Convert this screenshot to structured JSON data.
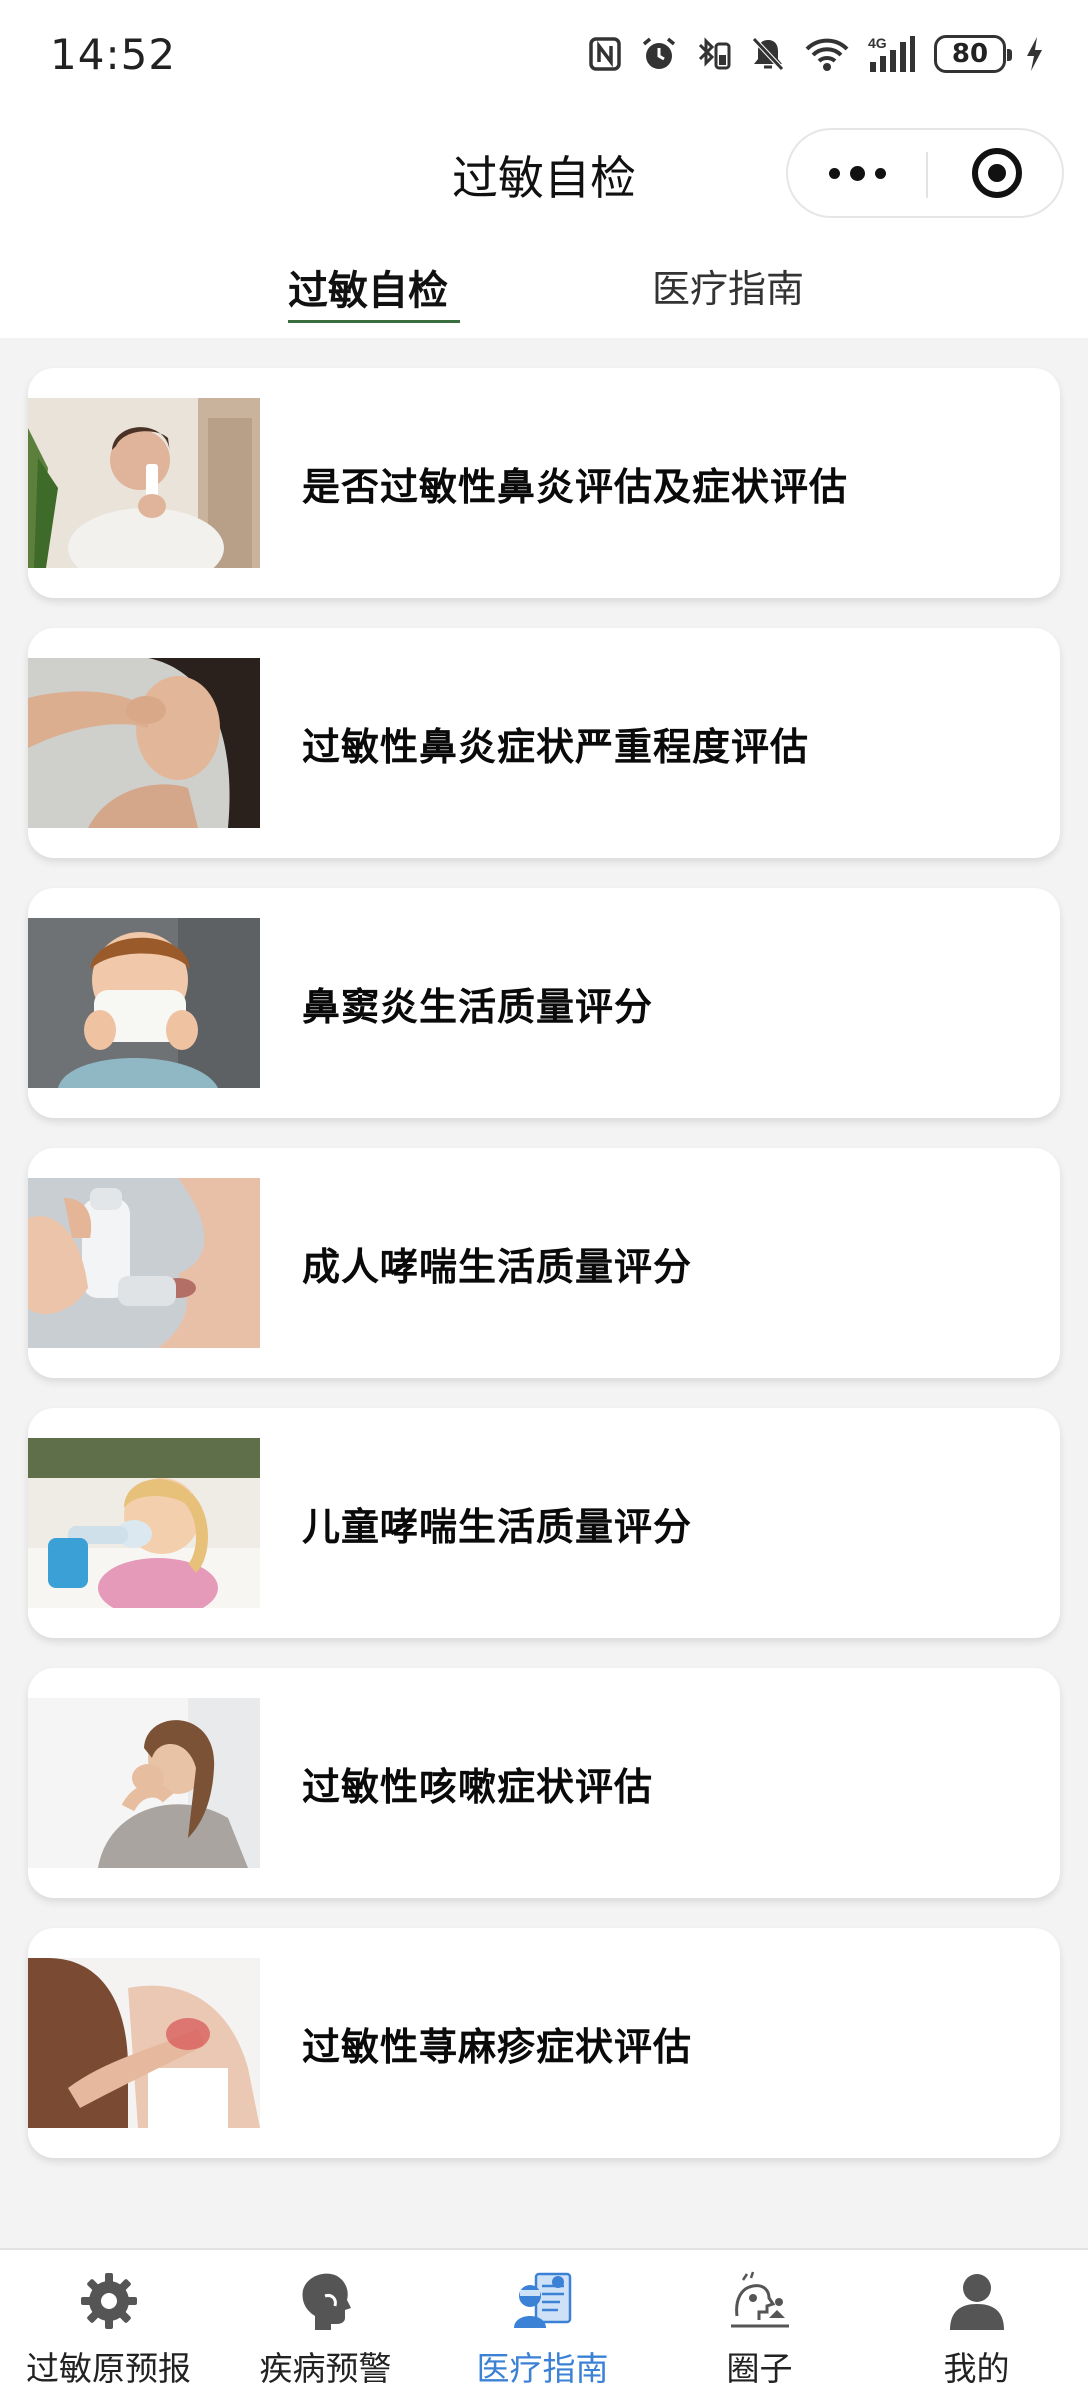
{
  "status_bar": {
    "time": "14:52",
    "battery": "80",
    "network": "4G",
    "icons": [
      "nfc-icon",
      "alarm-icon",
      "bluetooth-icon",
      "mute-icon",
      "wifi-icon",
      "signal-icon",
      "battery-icon",
      "charging-icon"
    ]
  },
  "nav": {
    "title": "过敏自检",
    "more_icon": "more-dots-icon",
    "close_icon": "target-close-icon"
  },
  "tabs": [
    {
      "label": "过敏自检",
      "active": true
    },
    {
      "label": "医疗指南",
      "active": false
    }
  ],
  "cards": [
    {
      "title": "是否过敏性鼻炎评估及症状评估",
      "image": "woman-nasal-spray-photo"
    },
    {
      "title": "过敏性鼻炎症状严重程度评估",
      "image": "woman-pinching-nose-photo"
    },
    {
      "title": "鼻窦炎生活质量评分",
      "image": "boy-blowing-nose-photo"
    },
    {
      "title": "成人哮喘生活质量评分",
      "image": "inhaler-photo"
    },
    {
      "title": "儿童哮喘生活质量评分",
      "image": "child-nebulizer-photo"
    },
    {
      "title": "过敏性咳嗽症状评估",
      "image": "woman-coughing-photo"
    },
    {
      "title": "过敏性荨麻疹症状评估",
      "image": "woman-scratching-arm-photo"
    }
  ],
  "bottom_tabs": [
    {
      "label": "过敏原预报",
      "icon": "gear-icon",
      "active": false
    },
    {
      "label": "疾病预警",
      "icon": "head-profile-icon",
      "active": false
    },
    {
      "label": "医疗指南",
      "icon": "doctor-clipboard-icon",
      "active": true
    },
    {
      "label": "圈子",
      "icon": "community-icon",
      "active": false
    },
    {
      "label": "我的",
      "icon": "user-icon",
      "active": false
    }
  ],
  "colors": {
    "active_tab_underline": "#3b6e3f",
    "bottom_active": "#3b82d6",
    "background": "#f3f3f3"
  }
}
